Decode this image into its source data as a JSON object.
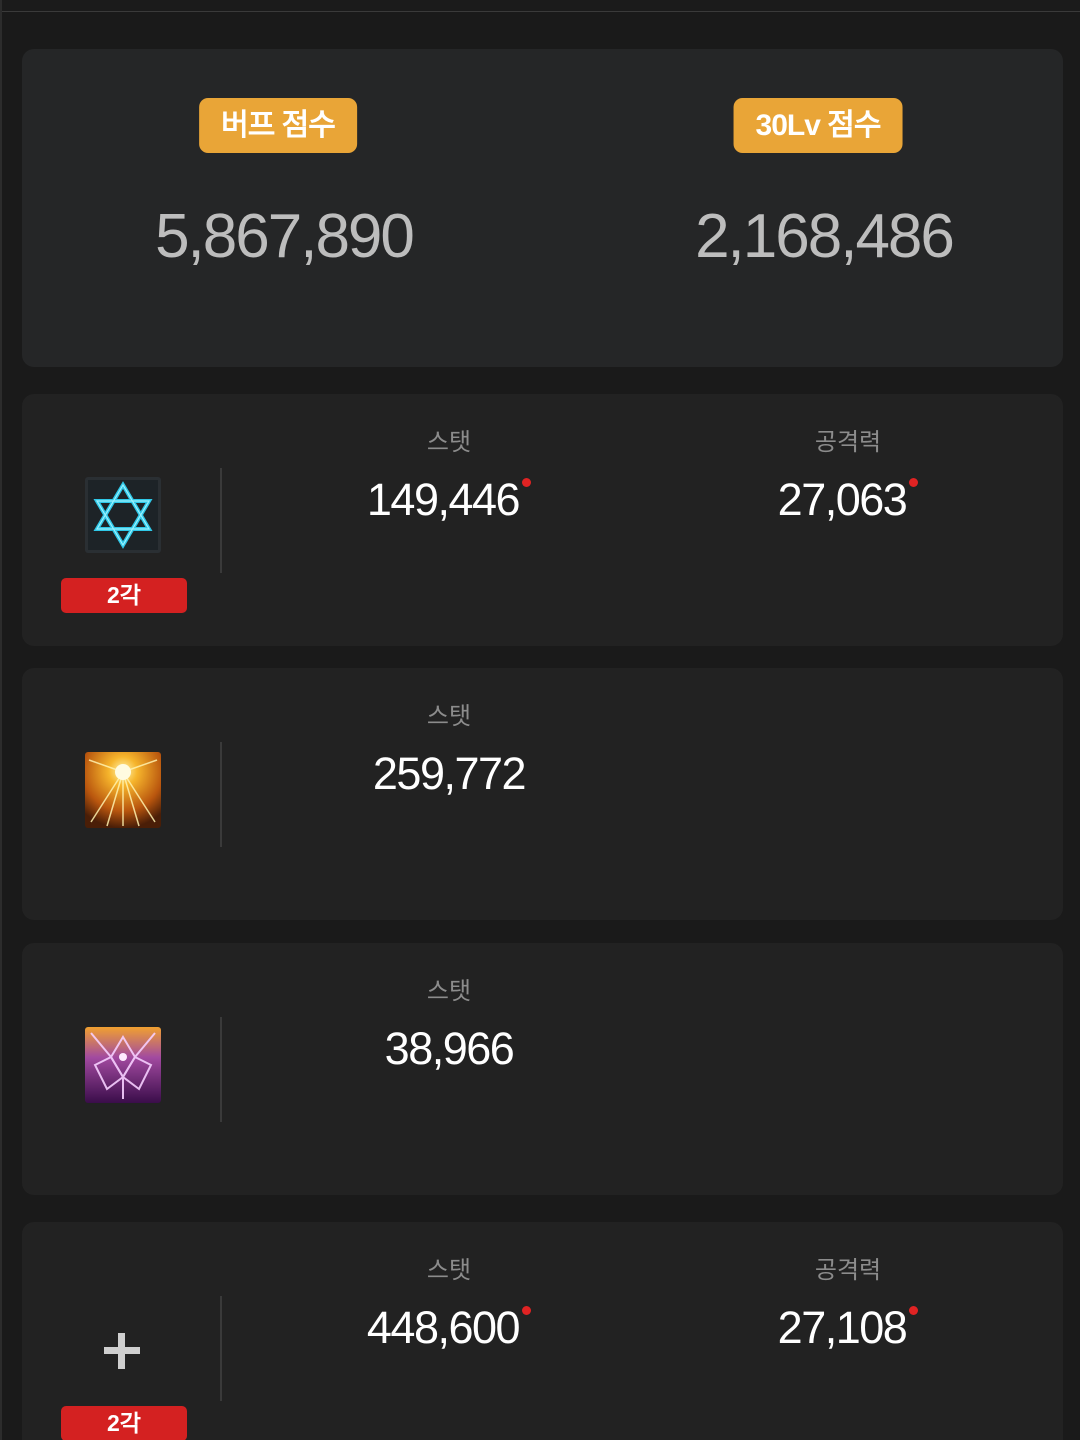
{
  "scores": {
    "buff_label": "버프 점수",
    "buff_value": "5,867,890",
    "level30_label": "30Lv 점수",
    "level30_value": "2,168,486"
  },
  "colors": {
    "badge_orange": "#e9a537",
    "grade_red": "#d42121",
    "dot_red": "#e02323",
    "panel_bg": "#252627",
    "card_bg": "#222222"
  },
  "buffs": [
    {
      "icon": "hexagram-icon",
      "grade": "2각",
      "stat_label": "스탯",
      "stat_value": "149,446",
      "stat_changed": true,
      "attack_label": "공격력",
      "attack_value": "27,063",
      "attack_changed": true
    },
    {
      "icon": "radiant-burst-icon",
      "stat_label": "스탯",
      "stat_value": "259,772",
      "stat_changed": false
    },
    {
      "icon": "violet-rune-icon",
      "stat_label": "스탯",
      "stat_value": "38,966",
      "stat_changed": false
    },
    {
      "icon": "plus-icon",
      "grade": "2각",
      "stat_label": "스탯",
      "stat_value": "448,600",
      "stat_changed": true,
      "attack_label": "공격력",
      "attack_value": "27,108",
      "attack_changed": true
    }
  ]
}
